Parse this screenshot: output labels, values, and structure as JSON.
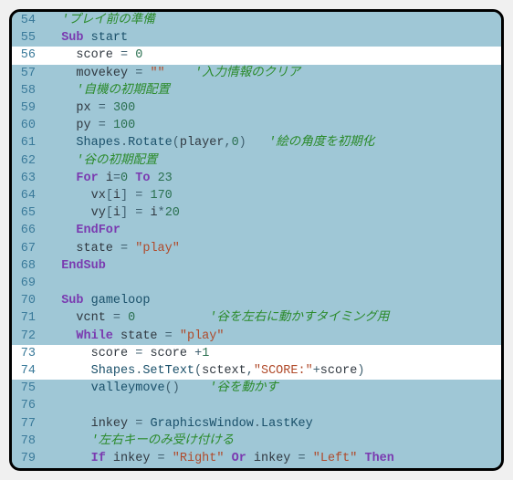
{
  "editor": {
    "lines": [
      {
        "n": 54,
        "hl": false,
        "seg": [
          {
            "c": "t-plain",
            "t": "  "
          },
          {
            "c": "t-comment",
            "t": "'プレイ前の準備"
          }
        ]
      },
      {
        "n": 55,
        "hl": false,
        "seg": [
          {
            "c": "t-plain",
            "t": "  "
          },
          {
            "c": "t-keyword",
            "t": "Sub"
          },
          {
            "c": "t-plain",
            "t": " "
          },
          {
            "c": "t-name",
            "t": "start"
          }
        ]
      },
      {
        "n": 56,
        "hl": true,
        "seg": [
          {
            "c": "t-plain",
            "t": "    "
          },
          {
            "c": "t-var",
            "t": "score"
          },
          {
            "c": "t-plain",
            "t": " "
          },
          {
            "c": "t-punct",
            "t": "="
          },
          {
            "c": "t-plain",
            "t": " "
          },
          {
            "c": "t-num",
            "t": "0"
          }
        ]
      },
      {
        "n": 57,
        "hl": false,
        "seg": [
          {
            "c": "t-plain",
            "t": "    "
          },
          {
            "c": "t-var",
            "t": "movekey"
          },
          {
            "c": "t-plain",
            "t": " "
          },
          {
            "c": "t-punct",
            "t": "="
          },
          {
            "c": "t-plain",
            "t": " "
          },
          {
            "c": "t-str",
            "t": "\"\""
          },
          {
            "c": "t-plain",
            "t": "    "
          },
          {
            "c": "t-comment",
            "t": "'入力情報のクリア"
          }
        ]
      },
      {
        "n": 58,
        "hl": false,
        "seg": [
          {
            "c": "t-plain",
            "t": "    "
          },
          {
            "c": "t-comment",
            "t": "'自機の初期配置"
          }
        ]
      },
      {
        "n": 59,
        "hl": false,
        "seg": [
          {
            "c": "t-plain",
            "t": "    "
          },
          {
            "c": "t-var",
            "t": "px"
          },
          {
            "c": "t-plain",
            "t": " "
          },
          {
            "c": "t-punct",
            "t": "="
          },
          {
            "c": "t-plain",
            "t": " "
          },
          {
            "c": "t-num",
            "t": "300"
          }
        ]
      },
      {
        "n": 60,
        "hl": false,
        "seg": [
          {
            "c": "t-plain",
            "t": "    "
          },
          {
            "c": "t-var",
            "t": "py"
          },
          {
            "c": "t-plain",
            "t": " "
          },
          {
            "c": "t-punct",
            "t": "="
          },
          {
            "c": "t-plain",
            "t": " "
          },
          {
            "c": "t-num",
            "t": "100"
          }
        ]
      },
      {
        "n": 61,
        "hl": false,
        "seg": [
          {
            "c": "t-plain",
            "t": "    "
          },
          {
            "c": "t-name",
            "t": "Shapes"
          },
          {
            "c": "t-punct",
            "t": "."
          },
          {
            "c": "t-name",
            "t": "Rotate"
          },
          {
            "c": "t-punct",
            "t": "("
          },
          {
            "c": "t-var",
            "t": "player"
          },
          {
            "c": "t-punct",
            "t": ","
          },
          {
            "c": "t-num",
            "t": "0"
          },
          {
            "c": "t-punct",
            "t": ")"
          },
          {
            "c": "t-plain",
            "t": "   "
          },
          {
            "c": "t-comment",
            "t": "'絵の角度を初期化"
          }
        ]
      },
      {
        "n": 62,
        "hl": false,
        "seg": [
          {
            "c": "t-plain",
            "t": "    "
          },
          {
            "c": "t-comment",
            "t": "'谷の初期配置"
          }
        ]
      },
      {
        "n": 63,
        "hl": false,
        "seg": [
          {
            "c": "t-plain",
            "t": "    "
          },
          {
            "c": "t-keyword",
            "t": "For"
          },
          {
            "c": "t-plain",
            "t": " "
          },
          {
            "c": "t-var",
            "t": "i"
          },
          {
            "c": "t-punct",
            "t": "="
          },
          {
            "c": "t-num",
            "t": "0"
          },
          {
            "c": "t-plain",
            "t": " "
          },
          {
            "c": "t-keyword",
            "t": "To"
          },
          {
            "c": "t-plain",
            "t": " "
          },
          {
            "c": "t-num",
            "t": "23"
          }
        ]
      },
      {
        "n": 64,
        "hl": false,
        "seg": [
          {
            "c": "t-plain",
            "t": "      "
          },
          {
            "c": "t-var",
            "t": "vx"
          },
          {
            "c": "t-punct",
            "t": "["
          },
          {
            "c": "t-var",
            "t": "i"
          },
          {
            "c": "t-punct",
            "t": "]"
          },
          {
            "c": "t-plain",
            "t": " "
          },
          {
            "c": "t-punct",
            "t": "="
          },
          {
            "c": "t-plain",
            "t": " "
          },
          {
            "c": "t-num",
            "t": "170"
          }
        ]
      },
      {
        "n": 65,
        "hl": false,
        "seg": [
          {
            "c": "t-plain",
            "t": "      "
          },
          {
            "c": "t-var",
            "t": "vy"
          },
          {
            "c": "t-punct",
            "t": "["
          },
          {
            "c": "t-var",
            "t": "i"
          },
          {
            "c": "t-punct",
            "t": "]"
          },
          {
            "c": "t-plain",
            "t": " "
          },
          {
            "c": "t-punct",
            "t": "="
          },
          {
            "c": "t-plain",
            "t": " "
          },
          {
            "c": "t-var",
            "t": "i"
          },
          {
            "c": "t-punct",
            "t": "*"
          },
          {
            "c": "t-num",
            "t": "20"
          }
        ]
      },
      {
        "n": 66,
        "hl": false,
        "seg": [
          {
            "c": "t-plain",
            "t": "    "
          },
          {
            "c": "t-keyword",
            "t": "EndFor"
          }
        ]
      },
      {
        "n": 67,
        "hl": false,
        "seg": [
          {
            "c": "t-plain",
            "t": "    "
          },
          {
            "c": "t-var",
            "t": "state"
          },
          {
            "c": "t-plain",
            "t": " "
          },
          {
            "c": "t-punct",
            "t": "="
          },
          {
            "c": "t-plain",
            "t": " "
          },
          {
            "c": "t-str",
            "t": "\"play\""
          }
        ]
      },
      {
        "n": 68,
        "hl": false,
        "seg": [
          {
            "c": "t-plain",
            "t": "  "
          },
          {
            "c": "t-keyword",
            "t": "EndSub"
          }
        ]
      },
      {
        "n": 69,
        "hl": false,
        "seg": [
          {
            "c": "t-plain",
            "t": "  "
          }
        ]
      },
      {
        "n": 70,
        "hl": false,
        "seg": [
          {
            "c": "t-plain",
            "t": "  "
          },
          {
            "c": "t-keyword",
            "t": "Sub"
          },
          {
            "c": "t-plain",
            "t": " "
          },
          {
            "c": "t-name",
            "t": "gameloop"
          }
        ]
      },
      {
        "n": 71,
        "hl": false,
        "seg": [
          {
            "c": "t-plain",
            "t": "    "
          },
          {
            "c": "t-var",
            "t": "vcnt"
          },
          {
            "c": "t-plain",
            "t": " "
          },
          {
            "c": "t-punct",
            "t": "="
          },
          {
            "c": "t-plain",
            "t": " "
          },
          {
            "c": "t-num",
            "t": "0"
          },
          {
            "c": "t-plain",
            "t": "          "
          },
          {
            "c": "t-comment",
            "t": "'谷を左右に動かすタイミング用"
          }
        ]
      },
      {
        "n": 72,
        "hl": false,
        "seg": [
          {
            "c": "t-plain",
            "t": "    "
          },
          {
            "c": "t-keyword",
            "t": "While"
          },
          {
            "c": "t-plain",
            "t": " "
          },
          {
            "c": "t-var",
            "t": "state"
          },
          {
            "c": "t-plain",
            "t": " "
          },
          {
            "c": "t-punct",
            "t": "="
          },
          {
            "c": "t-plain",
            "t": " "
          },
          {
            "c": "t-str",
            "t": "\"play\""
          }
        ]
      },
      {
        "n": 73,
        "hl": true,
        "seg": [
          {
            "c": "t-plain",
            "t": "      "
          },
          {
            "c": "t-var",
            "t": "score"
          },
          {
            "c": "t-plain",
            "t": " "
          },
          {
            "c": "t-punct",
            "t": "="
          },
          {
            "c": "t-plain",
            "t": " "
          },
          {
            "c": "t-var",
            "t": "score"
          },
          {
            "c": "t-plain",
            "t": " "
          },
          {
            "c": "t-punct",
            "t": "+"
          },
          {
            "c": "t-num",
            "t": "1"
          }
        ]
      },
      {
        "n": 74,
        "hl": true,
        "seg": [
          {
            "c": "t-plain",
            "t": "      "
          },
          {
            "c": "t-name",
            "t": "Shapes"
          },
          {
            "c": "t-punct",
            "t": "."
          },
          {
            "c": "t-name",
            "t": "SetText"
          },
          {
            "c": "t-punct",
            "t": "("
          },
          {
            "c": "t-var",
            "t": "sctext"
          },
          {
            "c": "t-punct",
            "t": ","
          },
          {
            "c": "t-str",
            "t": "\"SCORE:\""
          },
          {
            "c": "t-punct",
            "t": "+"
          },
          {
            "c": "t-var",
            "t": "score"
          },
          {
            "c": "t-punct",
            "t": ")"
          }
        ]
      },
      {
        "n": 75,
        "hl": false,
        "seg": [
          {
            "c": "t-plain",
            "t": "      "
          },
          {
            "c": "t-name",
            "t": "valleymove"
          },
          {
            "c": "t-punct",
            "t": "()"
          },
          {
            "c": "t-plain",
            "t": "    "
          },
          {
            "c": "t-comment",
            "t": "'谷を動かす"
          }
        ]
      },
      {
        "n": 76,
        "hl": false,
        "seg": [
          {
            "c": "t-plain",
            "t": "      "
          }
        ]
      },
      {
        "n": 77,
        "hl": false,
        "seg": [
          {
            "c": "t-plain",
            "t": "      "
          },
          {
            "c": "t-var",
            "t": "inkey"
          },
          {
            "c": "t-plain",
            "t": " "
          },
          {
            "c": "t-punct",
            "t": "="
          },
          {
            "c": "t-plain",
            "t": " "
          },
          {
            "c": "t-name",
            "t": "GraphicsWindow"
          },
          {
            "c": "t-punct",
            "t": "."
          },
          {
            "c": "t-name",
            "t": "LastKey"
          }
        ]
      },
      {
        "n": 78,
        "hl": false,
        "seg": [
          {
            "c": "t-plain",
            "t": "      "
          },
          {
            "c": "t-comment",
            "t": "'左右キーのみ受け付ける"
          }
        ]
      },
      {
        "n": 79,
        "hl": false,
        "seg": [
          {
            "c": "t-plain",
            "t": "      "
          },
          {
            "c": "t-keyword",
            "t": "If"
          },
          {
            "c": "t-plain",
            "t": " "
          },
          {
            "c": "t-var",
            "t": "inkey"
          },
          {
            "c": "t-plain",
            "t": " "
          },
          {
            "c": "t-punct",
            "t": "="
          },
          {
            "c": "t-plain",
            "t": " "
          },
          {
            "c": "t-str",
            "t": "\"Right\""
          },
          {
            "c": "t-plain",
            "t": " "
          },
          {
            "c": "t-keyword",
            "t": "Or"
          },
          {
            "c": "t-plain",
            "t": " "
          },
          {
            "c": "t-var",
            "t": "inkey"
          },
          {
            "c": "t-plain",
            "t": " "
          },
          {
            "c": "t-punct",
            "t": "="
          },
          {
            "c": "t-plain",
            "t": " "
          },
          {
            "c": "t-str",
            "t": "\"Left\""
          },
          {
            "c": "t-plain",
            "t": " "
          },
          {
            "c": "t-keyword",
            "t": "Then"
          }
        ]
      }
    ]
  }
}
